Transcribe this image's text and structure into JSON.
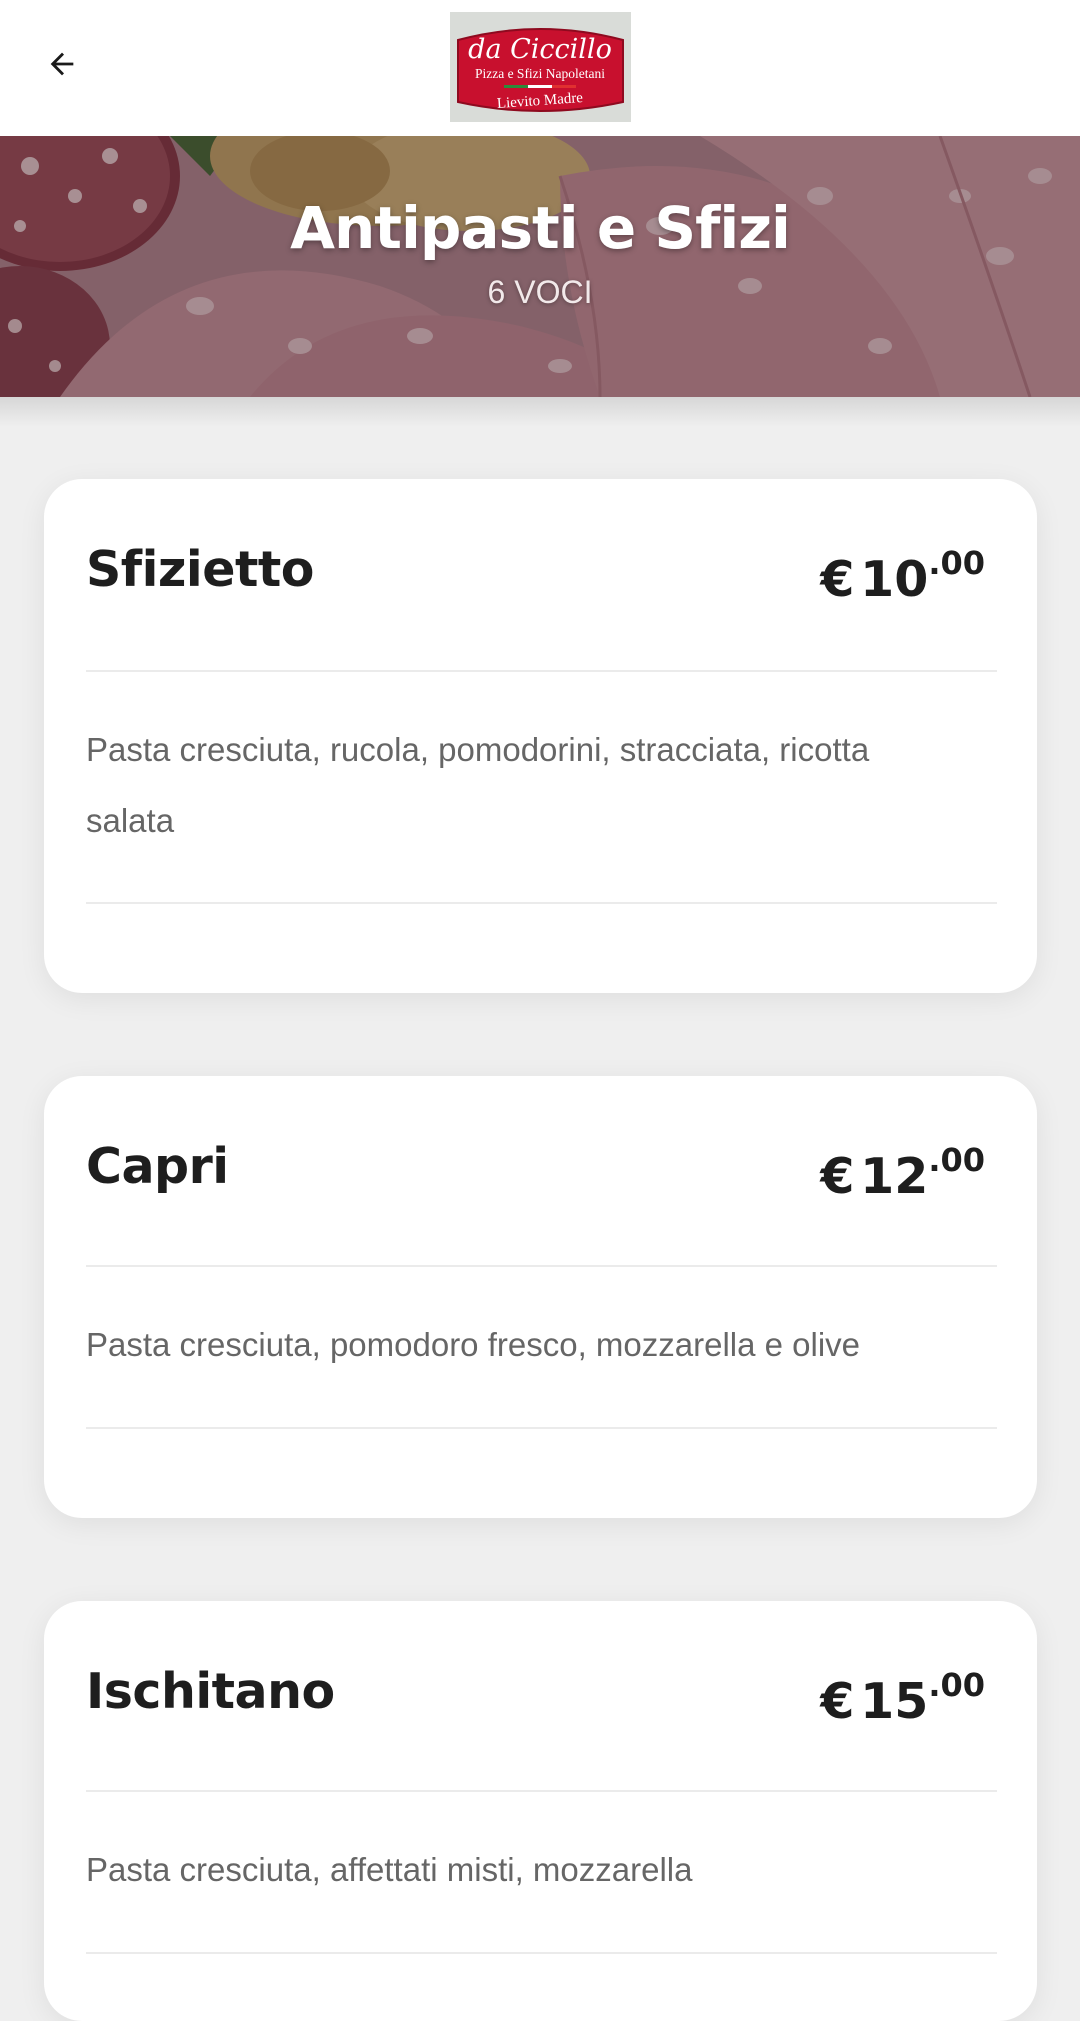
{
  "header": {
    "back_icon": "arrow-left-icon",
    "logo": {
      "line1": "da Ciccillo",
      "line2": "Pizza e Sfizi Napoletani",
      "line3": "Lievito Madre",
      "badge_color": "#c8102e"
    }
  },
  "category": {
    "title": "Antipasti e Sfizi",
    "count": "6 VOCI"
  },
  "items": [
    {
      "name": "Sfizietto",
      "currency": "€",
      "price_int": "10",
      "price_dec": ".00",
      "description": "Pasta cresciuta, rucola, pomodorini, stracciata, ricotta salata"
    },
    {
      "name": "Capri",
      "currency": "€",
      "price_int": "12",
      "price_dec": ".00",
      "description": "Pasta cresciuta, pomodoro fresco, mozzarella e olive"
    },
    {
      "name": "Ischitano",
      "currency": "€",
      "price_int": "15",
      "price_dec": ".00",
      "description": "Pasta cresciuta, affettati misti, mozzarella"
    }
  ],
  "colors": {
    "background": "#efefef",
    "card": "#ffffff",
    "text_primary": "#1e1e1e",
    "text_secondary": "#666666"
  }
}
